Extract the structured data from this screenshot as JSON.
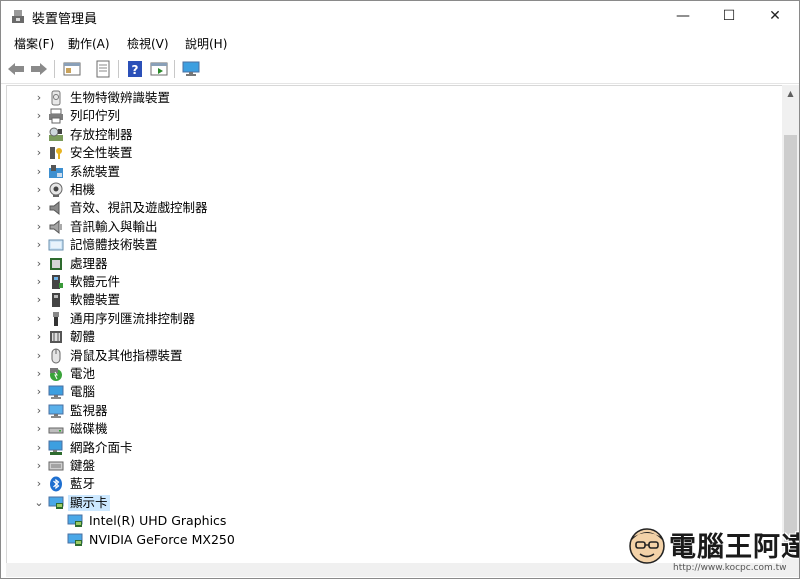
{
  "window": {
    "title": "裝置管理員",
    "minimize": "—",
    "maximize": "☐",
    "close": "✕"
  },
  "menu": [
    "檔案(F)",
    "動作(A)",
    "檢視(V)",
    "說明(H)"
  ],
  "toolbar": [
    "back-icon",
    "forward-icon",
    "properties-icon",
    "show-hide-icon",
    "help-icon",
    "run-icon",
    "monitor-icon"
  ],
  "tree": [
    {
      "label": "生物特徵辨識裝置",
      "icon": "biometric-icon",
      "expanded": false
    },
    {
      "label": "列印佇列",
      "icon": "printer-icon",
      "expanded": false
    },
    {
      "label": "存放控制器",
      "icon": "storage-controller-icon",
      "expanded": false
    },
    {
      "label": "安全性裝置",
      "icon": "security-device-icon",
      "expanded": false
    },
    {
      "label": "系統裝置",
      "icon": "system-device-icon",
      "expanded": false
    },
    {
      "label": "相機",
      "icon": "camera-icon",
      "expanded": false
    },
    {
      "label": "音效、視訊及遊戲控制器",
      "icon": "speaker-icon",
      "expanded": false
    },
    {
      "label": "音訊輸入與輸出",
      "icon": "audio-io-icon",
      "expanded": false
    },
    {
      "label": "記憶體技術裝置",
      "icon": "memory-icon",
      "expanded": false
    },
    {
      "label": "處理器",
      "icon": "processor-icon",
      "expanded": false
    },
    {
      "label": "軟體元件",
      "icon": "software-component-icon",
      "expanded": false
    },
    {
      "label": "軟體裝置",
      "icon": "software-device-icon",
      "expanded": false
    },
    {
      "label": "通用序列匯流排控制器",
      "icon": "usb-icon",
      "expanded": false
    },
    {
      "label": "韌體",
      "icon": "firmware-icon",
      "expanded": false
    },
    {
      "label": "滑鼠及其他指標裝置",
      "icon": "mouse-icon",
      "expanded": false
    },
    {
      "label": "電池",
      "icon": "battery-icon",
      "expanded": false
    },
    {
      "label": "電腦",
      "icon": "computer-icon",
      "expanded": false
    },
    {
      "label": "監視器",
      "icon": "monitor-icon",
      "expanded": false
    },
    {
      "label": "磁碟機",
      "icon": "disk-icon",
      "expanded": false
    },
    {
      "label": "網路介面卡",
      "icon": "network-icon",
      "expanded": false
    },
    {
      "label": "鍵盤",
      "icon": "keyboard-icon",
      "expanded": false
    },
    {
      "label": "藍牙",
      "icon": "bluetooth-icon",
      "expanded": false
    },
    {
      "label": "顯示卡",
      "icon": "display-adapter-icon",
      "expanded": true,
      "selected": true
    },
    {
      "label": "Intel(R) UHD Graphics",
      "icon": "display-adapter-icon",
      "child": true
    },
    {
      "label": "NVIDIA GeForce MX250",
      "icon": "display-adapter-icon",
      "child": true
    }
  ],
  "watermark": {
    "text": "電腦王阿達",
    "url": "http://www.kocpc.com.tw"
  },
  "colors": {
    "selection": "#cce8ff",
    "accent_blue": "#1e88d8"
  }
}
